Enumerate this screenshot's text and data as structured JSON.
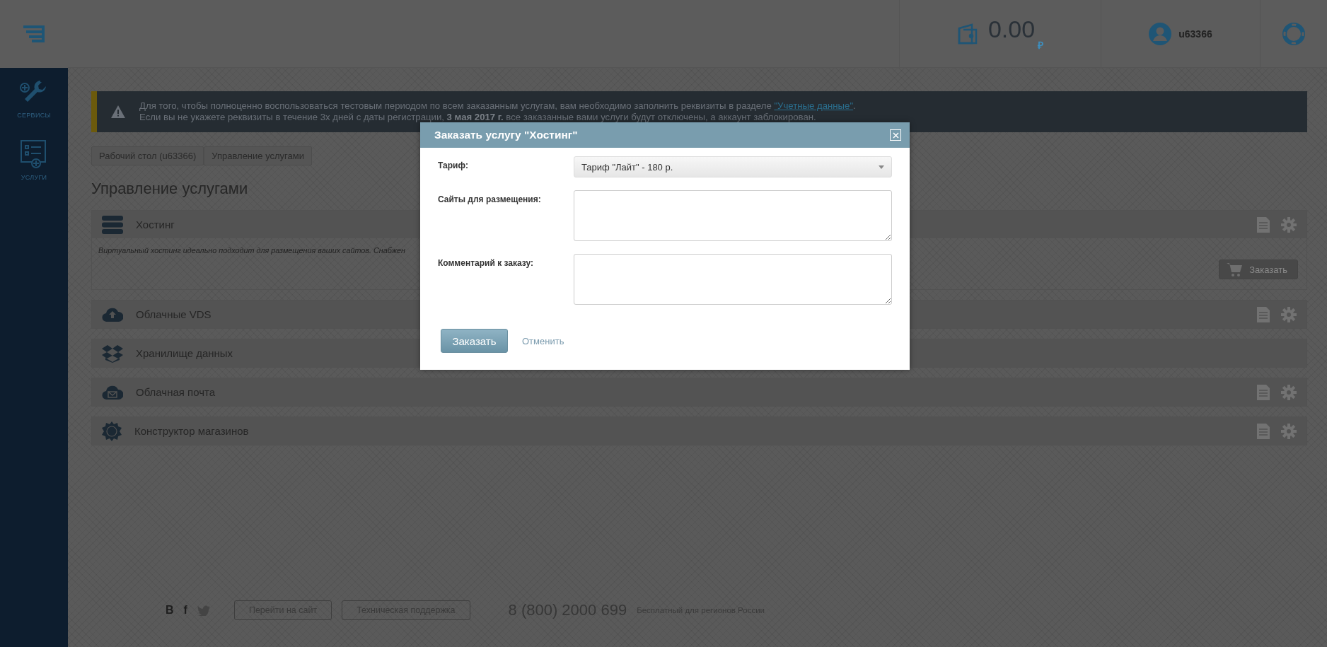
{
  "header": {
    "balance": "0.00",
    "currency": "₽",
    "username": "u63366"
  },
  "sidebar": {
    "items": [
      {
        "label": "СЕРВИСЫ",
        "kind": "services"
      },
      {
        "label": "УСЛУГИ",
        "kind": "orders"
      }
    ]
  },
  "notice": {
    "text": "Для того, чтобы полноценно воспользоваться тестовым периодом по всем заказанным услугам, вам необходимо заполнить реквизиты в разделе ",
    "link": "\"Учетные данные\"",
    "text_end": ".",
    "text_2": "Если вы не укажете реквизиты в течение 3х дней с даты регистрации, **3 мая 2017 г.** все заказанные вами услуги будут отключены, а аккаунт заблокирован."
  },
  "breadcrumbs": [
    {
      "label": "Рабочий стол (u63366)"
    },
    {
      "label": "Управление услугами"
    }
  ],
  "page_title": "Управление услугами",
  "services": [
    {
      "name": "Хостинг",
      "kind": "hosting",
      "expanded": true,
      "has_actions": true,
      "description": "Виртуальный хостинг идеально подходит для размещения ваших сайтов. Снабжен",
      "order_button": "Заказать"
    },
    {
      "name": "Облачные VDS",
      "kind": "vds",
      "expanded": false,
      "has_actions": true
    },
    {
      "name": "Хранилище данных",
      "kind": "storage",
      "expanded": false,
      "has_actions": false
    },
    {
      "name": "Облачная почта",
      "kind": "mail",
      "expanded": false,
      "has_actions": true
    },
    {
      "name": "Конструктор магазинов",
      "kind": "shop",
      "expanded": false,
      "has_actions": true
    }
  ],
  "footer": {
    "social": [
      "В",
      "f"
    ],
    "links": [
      "Перейти на сайт",
      "Техническая поддержка"
    ],
    "phone": "8 (800) 2000 699",
    "phone_note": "Бесплатный для регионов России"
  },
  "modal": {
    "title": "Заказать услугу \"Хостинг\"",
    "fields": [
      {
        "label": "Тариф:",
        "kind": "select",
        "value": "Тариф \"Лайт\" - 180 р."
      },
      {
        "label": "Сайты для размещения:",
        "kind": "textarea"
      },
      {
        "label": "Комментарий к заказу:",
        "kind": "textarea"
      }
    ],
    "submit": "Заказать",
    "cancel": "Отменить"
  }
}
